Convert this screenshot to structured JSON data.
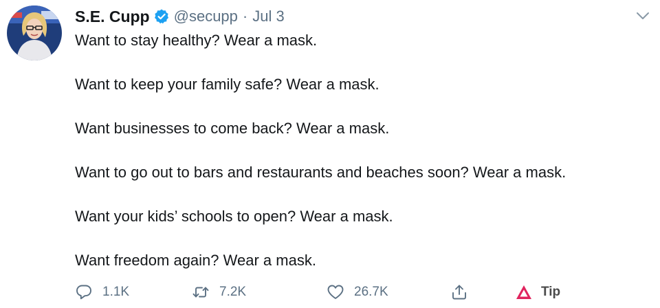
{
  "author": {
    "display_name": "S.E. Cupp",
    "handle": "@secupp",
    "separator": "·",
    "date": "Jul 3",
    "verified_icon": "verified-badge-icon",
    "avatar_icon": "avatar"
  },
  "tweet": {
    "lines": [
      "Want to stay healthy? Wear a mask.",
      "Want to keep your family safe? Wear a mask.",
      "Want businesses to come back? Wear a mask.",
      "Want to go out to bars and restaurants and beaches soon? Wear a mask.",
      "Want your kids’ schools to open? Wear a mask.",
      "Want freedom again? Wear a mask."
    ]
  },
  "actions": {
    "reply": {
      "icon": "reply-icon",
      "count": "1.1K"
    },
    "retweet": {
      "icon": "retweet-icon",
      "count": "7.2K"
    },
    "like": {
      "icon": "heart-icon",
      "count": "26.7K"
    },
    "share": {
      "icon": "share-icon"
    },
    "tip": {
      "icon": "tip-icon",
      "label": "Tip"
    }
  },
  "colors": {
    "text": "#14171a",
    "muted": "#5b7083",
    "verified": "#1da1f2",
    "tip": "#e0245e"
  }
}
